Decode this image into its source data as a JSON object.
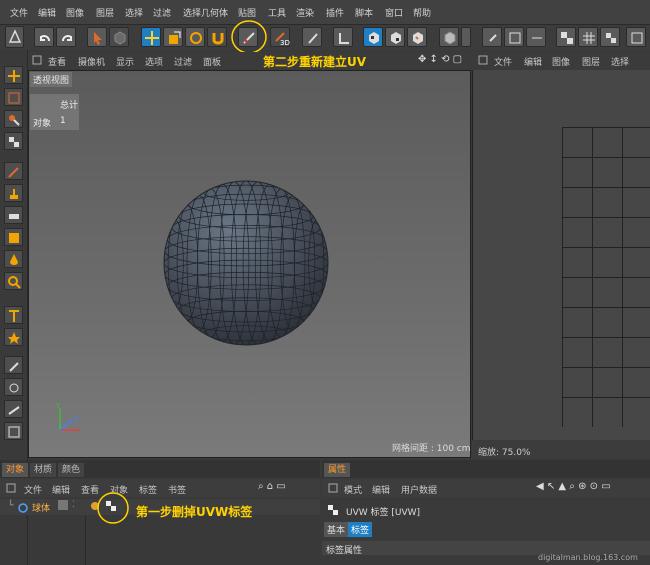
{
  "menu": [
    "文件",
    "编辑",
    "图像",
    "图层",
    "选择",
    "过滤",
    "选择几何体",
    "贴图",
    "工具",
    "渲染",
    "插件",
    "脚本",
    "窗口",
    "帮助"
  ],
  "viewport": {
    "label": "透视视图",
    "menu": [
      "查看",
      "摄像机",
      "显示",
      "选项",
      "过滤",
      "面板"
    ],
    "stats": {
      "header": "总计",
      "row_label": "对象",
      "row_value": "1"
    },
    "grid_spacing": "网格间距 : 100 cm",
    "annotation": "第二步重新建立UV"
  },
  "uv_editor": {
    "menu": [
      "文件",
      "编辑",
      "图像",
      "图层",
      "选择"
    ],
    "zoom": "缩放: 75.0%"
  },
  "objects": {
    "tabs": [
      "对象",
      "材质",
      "颜色"
    ],
    "menu": [
      "文件",
      "编辑",
      "查看",
      "对象",
      "标签",
      "书签"
    ],
    "item_name": "球体",
    "annotation": "第一步删掉UVW标签"
  },
  "attributes": {
    "tab": "属性",
    "menu": [
      "模式",
      "编辑",
      "用户数据"
    ],
    "title": "UVW 标签 [UVW]",
    "subtabs": [
      "基本",
      "标签"
    ],
    "section": "标签属性"
  },
  "watermark": "digitalman.blog.163.com",
  "colors": {
    "accent": "#1e7fc2",
    "annotation": "#ffd300",
    "active_tab": "#ff9a2a"
  }
}
